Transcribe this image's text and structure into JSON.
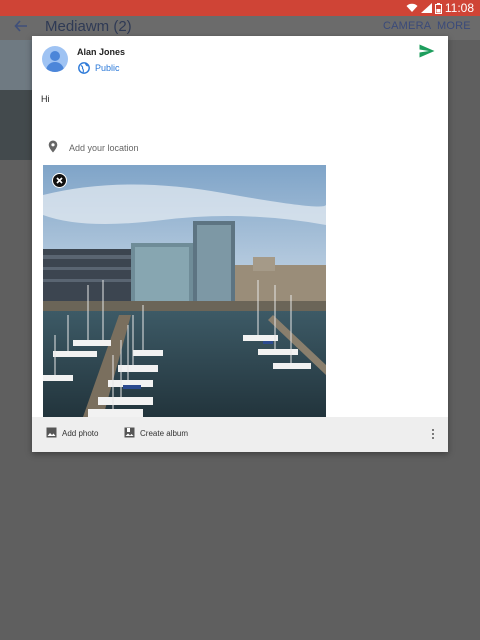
{
  "status_bar": {
    "time": "11:08",
    "icons": [
      "wifi-icon",
      "signal-icon",
      "battery-icon"
    ]
  },
  "app_bar": {
    "title": "Mediawm (2)",
    "actions": [
      "CAMERA",
      "MORE"
    ]
  },
  "composer": {
    "user_name": "Alan Jones",
    "visibility": "Public",
    "post_text": "Hi",
    "location_placeholder": "Add your location",
    "photo_description": "marina with sailboats and office buildings"
  },
  "footer": {
    "add_photo": "Add photo",
    "create_album": "Create album"
  },
  "colors": {
    "status_bar": "#cf4436",
    "accent_blue": "#2a78d8",
    "send_green": "#1e9e5d",
    "scrim": "#5f5f5f"
  }
}
